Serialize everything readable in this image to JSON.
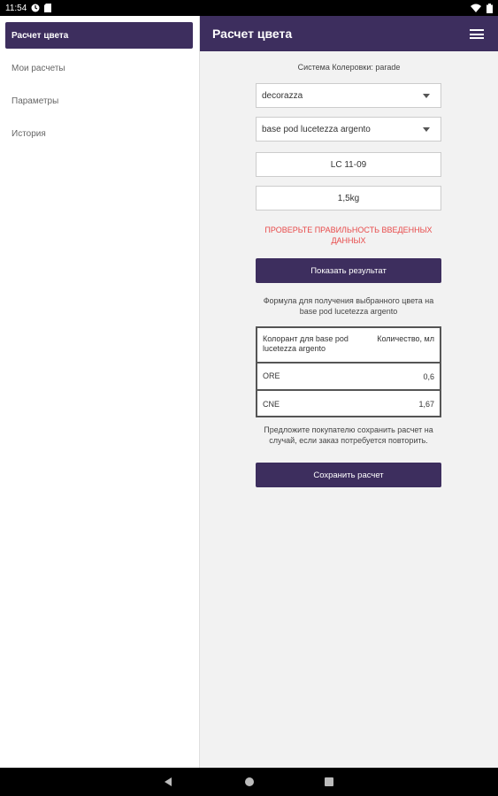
{
  "status": {
    "time": "11:54"
  },
  "sidebar": {
    "items": [
      {
        "label": "Расчет цвета"
      },
      {
        "label": "Мои расчеты"
      },
      {
        "label": "Параметры"
      },
      {
        "label": "История"
      }
    ]
  },
  "appbar": {
    "title": "Расчет цвета"
  },
  "form": {
    "system_label": "Система Колеровки: parade",
    "brand_select": "decorazza",
    "base_select": "base pod lucetezza argento",
    "color_code": "LC 11-09",
    "volume": "1,5kg",
    "error": "ПРОВЕРЬТЕ ПРАВИЛЬНОСТЬ ВВЕДЕННЫХ ДАННЫХ",
    "show_button": "Показать результат"
  },
  "result": {
    "formula_caption": "Формула для получения выбранного цвета на base pod lucetezza argento",
    "table": {
      "header": {
        "col1": "Колорант для base pod lucetezza argento",
        "col2": "Количество, мл"
      },
      "rows": [
        {
          "colorant": "ORE",
          "amount": "0,6"
        },
        {
          "colorant": "CNE",
          "amount": "1,67"
        }
      ]
    },
    "note": "Предложите покупателю сохранить расчет на случай, если заказ потребуется повторить.",
    "save_button": "Сохранить расчет"
  },
  "colors": {
    "primary": "#3d2e5e",
    "error": "#e84a4a",
    "background": "#f2f2f2"
  }
}
